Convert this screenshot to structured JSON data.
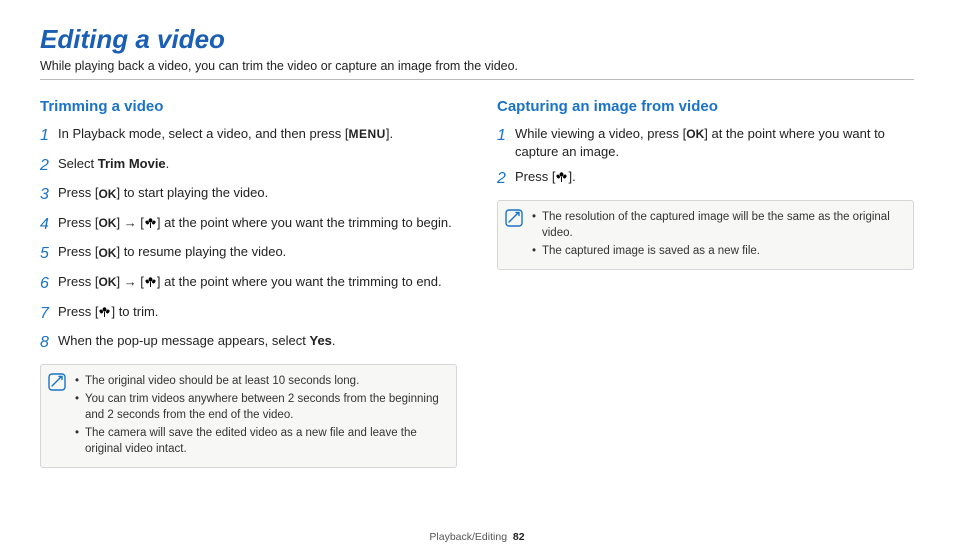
{
  "page": {
    "title": "Editing a video",
    "subtitle": "While playing back a video, you can trim the video or capture an image from the video.",
    "footer_section": "Playback/Editing",
    "footer_page": "82"
  },
  "icons": {
    "menu": "MENU",
    "ok": "OK",
    "arrow": "→"
  },
  "left": {
    "heading": "Trimming a video",
    "steps": [
      {
        "n": "1",
        "pre": "In Playback mode, select a video, and then press [",
        "icon": "menu",
        "post": "]."
      },
      {
        "n": "2",
        "pre": "Select ",
        "bold": "Trim Movie",
        "post": "."
      },
      {
        "n": "3",
        "pre": "Press [",
        "icon": "ok",
        "post": "] to start playing the video."
      },
      {
        "n": "4",
        "pre": "Press [",
        "icon": "ok",
        "mid1": "] ",
        "arrow": true,
        "mid2": " [",
        "icon2": "down",
        "post": "] at the point where you want the trimming to begin."
      },
      {
        "n": "5",
        "pre": "Press [",
        "icon": "ok",
        "post": "] to resume playing the video."
      },
      {
        "n": "6",
        "pre": "Press [",
        "icon": "ok",
        "mid1": "] ",
        "arrow": true,
        "mid2": " [",
        "icon2": "down",
        "post": "] at the point where you want the trimming to end."
      },
      {
        "n": "7",
        "pre": "Press [",
        "icon": "down",
        "post": "] to trim."
      },
      {
        "n": "8",
        "pre": "When the pop-up message appears, select ",
        "bold": "Yes",
        "post": "."
      }
    ],
    "notes": [
      "The original video should be at least 10 seconds long.",
      "You can trim videos anywhere between 2 seconds from the beginning and 2 seconds from the end of the video.",
      "The camera will save the edited video as a new file and leave the original video intact."
    ]
  },
  "right": {
    "heading": "Capturing an image from video",
    "steps": [
      {
        "n": "1",
        "pre": "While viewing a video, press [",
        "icon": "ok",
        "post": "] at the point where you want to capture an image."
      },
      {
        "n": "2",
        "pre": "Press [",
        "icon": "down",
        "post": "]."
      }
    ],
    "notes": [
      "The resolution of the captured image will be the same as the original video.",
      "The captured image is saved as a new file."
    ]
  }
}
